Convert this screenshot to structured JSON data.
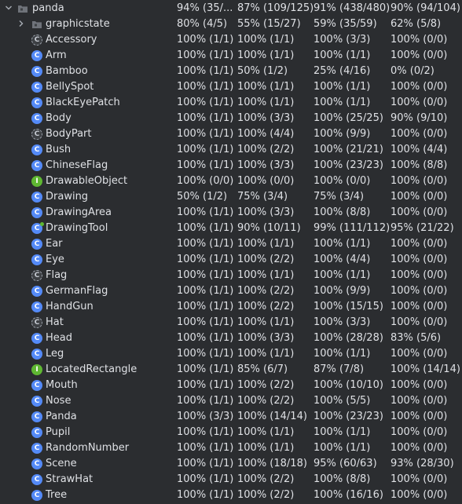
{
  "root": {
    "name": "panda",
    "c1": "94% (35/...",
    "c2": "87% (109/125)",
    "c3": "91% (438/480)",
    "c4": "90% (94/104)"
  },
  "package": {
    "name": "graphicstate",
    "c1": "80% (4/5)",
    "c2": "55% (15/27)",
    "c3": "59% (35/59)",
    "c4": "62% (5/8)"
  },
  "rows": [
    {
      "name": "Accessory",
      "kind": "abstract",
      "c1": "100% (1/1)",
      "c2": "100% (1/1)",
      "c3": "100% (3/3)",
      "c4": "100% (0/0)"
    },
    {
      "name": "Arm",
      "kind": "class",
      "c1": "100% (1/1)",
      "c2": "100% (1/1)",
      "c3": "100% (1/1)",
      "c4": "100% (0/0)"
    },
    {
      "name": "Bamboo",
      "kind": "class",
      "c1": "100% (1/1)",
      "c2": "50% (1/2)",
      "c3": "25% (4/16)",
      "c4": "0% (0/2)"
    },
    {
      "name": "BellySpot",
      "kind": "class",
      "c1": "100% (1/1)",
      "c2": "100% (1/1)",
      "c3": "100% (1/1)",
      "c4": "100% (0/0)"
    },
    {
      "name": "BlackEyePatch",
      "kind": "class",
      "c1": "100% (1/1)",
      "c2": "100% (1/1)",
      "c3": "100% (1/1)",
      "c4": "100% (0/0)"
    },
    {
      "name": "Body",
      "kind": "class",
      "c1": "100% (1/1)",
      "c2": "100% (3/3)",
      "c3": "100% (25/25)",
      "c4": "90% (9/10)"
    },
    {
      "name": "BodyPart",
      "kind": "abstract",
      "c1": "100% (1/1)",
      "c2": "100% (4/4)",
      "c3": "100% (9/9)",
      "c4": "100% (0/0)"
    },
    {
      "name": "Bush",
      "kind": "class",
      "c1": "100% (1/1)",
      "c2": "100% (2/2)",
      "c3": "100% (21/21)",
      "c4": "100% (4/4)"
    },
    {
      "name": "ChineseFlag",
      "kind": "class",
      "c1": "100% (1/1)",
      "c2": "100% (3/3)",
      "c3": "100% (23/23)",
      "c4": "100% (8/8)"
    },
    {
      "name": "DrawableObject",
      "kind": "interface",
      "c1": "100% (0/0)",
      "c2": "100% (0/0)",
      "c3": "100% (0/0)",
      "c4": "100% (0/0)"
    },
    {
      "name": "Drawing",
      "kind": "class",
      "c1": "50% (1/2)",
      "c2": "75% (3/4)",
      "c3": "75% (3/4)",
      "c4": "100% (0/0)"
    },
    {
      "name": "DrawingArea",
      "kind": "class",
      "c1": "100% (1/1)",
      "c2": "100% (3/3)",
      "c3": "100% (8/8)",
      "c4": "100% (0/0)"
    },
    {
      "name": "DrawingTool",
      "kind": "class-main",
      "c1": "100% (1/1)",
      "c2": "90% (10/11)",
      "c3": "99% (111/112)",
      "c4": "95% (21/22)"
    },
    {
      "name": "Ear",
      "kind": "class",
      "c1": "100% (1/1)",
      "c2": "100% (1/1)",
      "c3": "100% (1/1)",
      "c4": "100% (0/0)"
    },
    {
      "name": "Eye",
      "kind": "class",
      "c1": "100% (1/1)",
      "c2": "100% (2/2)",
      "c3": "100% (4/4)",
      "c4": "100% (0/0)"
    },
    {
      "name": "Flag",
      "kind": "abstract",
      "c1": "100% (1/1)",
      "c2": "100% (1/1)",
      "c3": "100% (1/1)",
      "c4": "100% (0/0)"
    },
    {
      "name": "GermanFlag",
      "kind": "class",
      "c1": "100% (1/1)",
      "c2": "100% (2/2)",
      "c3": "100% (9/9)",
      "c4": "100% (0/0)"
    },
    {
      "name": "HandGun",
      "kind": "class",
      "c1": "100% (1/1)",
      "c2": "100% (2/2)",
      "c3": "100% (15/15)",
      "c4": "100% (0/0)"
    },
    {
      "name": "Hat",
      "kind": "abstract",
      "c1": "100% (1/1)",
      "c2": "100% (1/1)",
      "c3": "100% (3/3)",
      "c4": "100% (0/0)"
    },
    {
      "name": "Head",
      "kind": "class",
      "c1": "100% (1/1)",
      "c2": "100% (3/3)",
      "c3": "100% (28/28)",
      "c4": "83% (5/6)"
    },
    {
      "name": "Leg",
      "kind": "class",
      "c1": "100% (1/1)",
      "c2": "100% (1/1)",
      "c3": "100% (1/1)",
      "c4": "100% (0/0)"
    },
    {
      "name": "LocatedRectangle",
      "kind": "interface",
      "c1": "100% (1/1)",
      "c2": "85% (6/7)",
      "c3": "87% (7/8)",
      "c4": "100% (14/14)"
    },
    {
      "name": "Mouth",
      "kind": "class",
      "c1": "100% (1/1)",
      "c2": "100% (2/2)",
      "c3": "100% (10/10)",
      "c4": "100% (0/0)"
    },
    {
      "name": "Nose",
      "kind": "class",
      "c1": "100% (1/1)",
      "c2": "100% (2/2)",
      "c3": "100% (5/5)",
      "c4": "100% (0/0)"
    },
    {
      "name": "Panda",
      "kind": "class",
      "c1": "100% (3/3)",
      "c2": "100% (14/14)",
      "c3": "100% (23/23)",
      "c4": "100% (0/0)"
    },
    {
      "name": "Pupil",
      "kind": "class",
      "c1": "100% (1/1)",
      "c2": "100% (1/1)",
      "c3": "100% (1/1)",
      "c4": "100% (0/0)"
    },
    {
      "name": "RandomNumber",
      "kind": "class",
      "c1": "100% (1/1)",
      "c2": "100% (1/1)",
      "c3": "100% (1/1)",
      "c4": "100% (0/0)"
    },
    {
      "name": "Scene",
      "kind": "class",
      "c1": "100% (1/1)",
      "c2": "100% (18/18)",
      "c3": "95% (60/63)",
      "c4": "93% (28/30)"
    },
    {
      "name": "StrawHat",
      "kind": "class",
      "c1": "100% (1/1)",
      "c2": "100% (2/2)",
      "c3": "100% (8/8)",
      "c4": "100% (0/0)"
    },
    {
      "name": "Tree",
      "kind": "class",
      "c1": "100% (1/1)",
      "c2": "100% (2/2)",
      "c3": "100% (16/16)",
      "c4": "100% (0/0)"
    }
  ],
  "icons": {
    "class_letter": "C",
    "interface_letter": "I"
  },
  "colors": {
    "background": "#2b2d30",
    "text": "#dfe1e5",
    "class_icon": "#548af7",
    "interface_icon": "#5fb832"
  }
}
